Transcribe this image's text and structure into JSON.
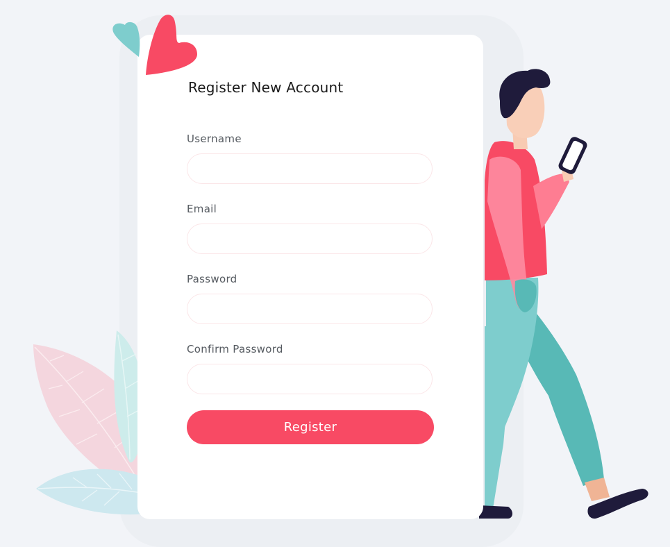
{
  "form": {
    "title": "Register New Account",
    "fields": [
      {
        "label": "Username",
        "value": "",
        "placeholder": ""
      },
      {
        "label": "Email",
        "value": "",
        "placeholder": ""
      },
      {
        "label": "Password",
        "value": "",
        "placeholder": ""
      },
      {
        "label": "Confirm Password",
        "value": "",
        "placeholder": ""
      }
    ],
    "submit_label": "Register"
  },
  "colors": {
    "accent": "#f84a64",
    "background": "#f2f4f8",
    "teal": "#7ecdcd"
  },
  "illustrations": [
    "heart-teal",
    "heart-pink",
    "leaf-pink",
    "leaf-teal",
    "leaf-light-blue",
    "walking-person-with-phone"
  ]
}
